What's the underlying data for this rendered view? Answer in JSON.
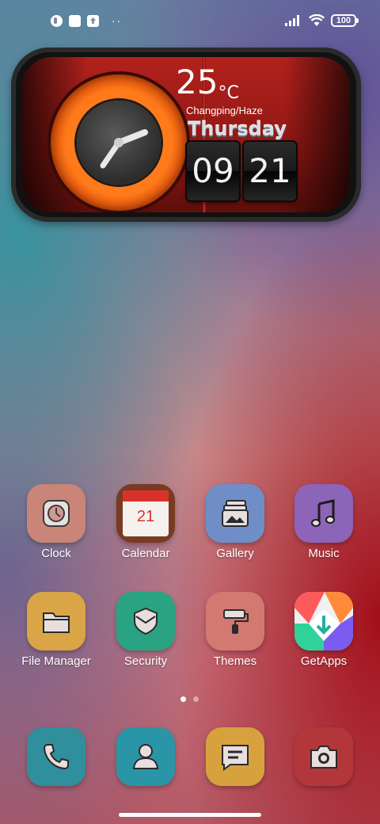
{
  "status_bar": {
    "dots": "··",
    "battery": "100"
  },
  "widget": {
    "temperature": "25",
    "unit": "°C",
    "location": "Changping/Haze",
    "day": "Thursday",
    "hour": "09",
    "minute": "21"
  },
  "apps": [
    {
      "label": "Clock",
      "icon": "clock-icon",
      "color": "#c98578"
    },
    {
      "label": "Calendar",
      "icon": "calendar-icon",
      "color": "#7a3a22",
      "date": "21"
    },
    {
      "label": "Gallery",
      "icon": "gallery-icon",
      "color": "#6f8ec8"
    },
    {
      "label": "Music",
      "icon": "music-note-icon",
      "color": "#8c64b8"
    },
    {
      "label": "File Manager",
      "icon": "folder-icon",
      "color": "#d9a546"
    },
    {
      "label": "Security",
      "icon": "shield-icon",
      "color": "#2aa382"
    },
    {
      "label": "Themes",
      "icon": "paint-roller-icon",
      "color": "#d27a72"
    },
    {
      "label": "GetApps",
      "icon": "getapps-icon",
      "color": "#f0f0f0"
    }
  ],
  "dock": [
    {
      "name": "phone",
      "icon": "phone-icon",
      "color": "#2f8f9c"
    },
    {
      "name": "contacts",
      "icon": "contacts-icon",
      "color": "#2a95a6"
    },
    {
      "name": "messages",
      "icon": "message-icon",
      "color": "#d7a23e"
    },
    {
      "name": "camera",
      "icon": "camera-icon",
      "color": "#b3373a"
    }
  ],
  "page_indicator": {
    "pages": 2,
    "current": 1
  }
}
